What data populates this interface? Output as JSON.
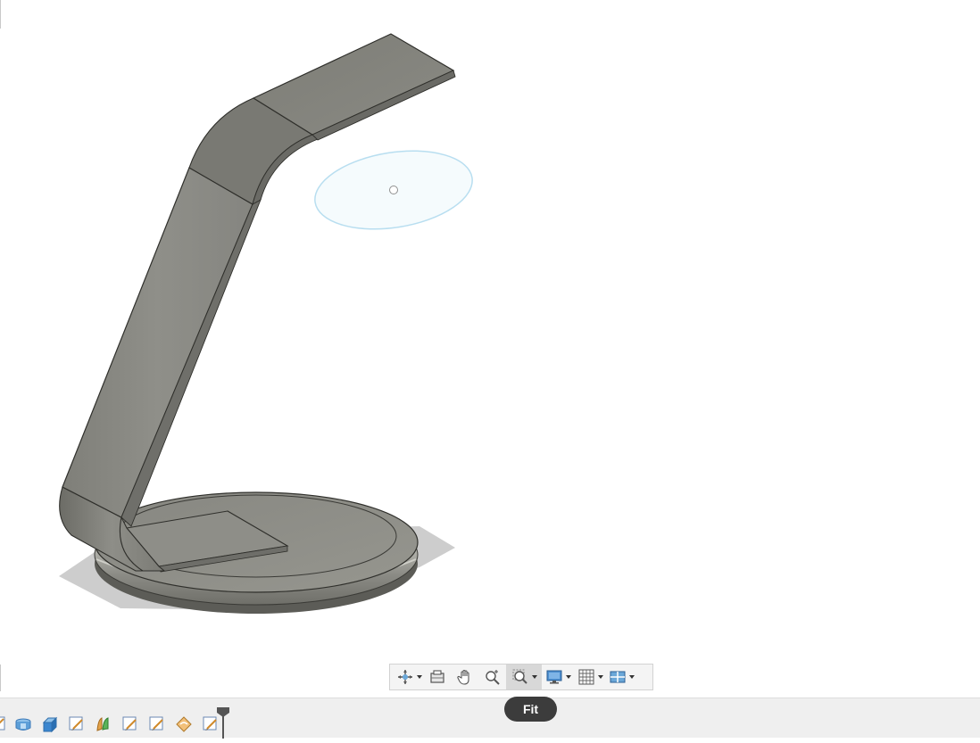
{
  "viewport": {
    "model": "lamp-stand-body",
    "sketch": "circle-sketch"
  },
  "navigation_toolbar": {
    "tools": [
      {
        "name": "orbit",
        "icon": "orbit-icon",
        "has_dropdown": true
      },
      {
        "name": "look-at",
        "icon": "look-at-icon",
        "has_dropdown": false
      },
      {
        "name": "pan",
        "icon": "pan-hand-icon",
        "has_dropdown": false
      },
      {
        "name": "zoom",
        "icon": "zoom-icon",
        "has_dropdown": false
      },
      {
        "name": "fit",
        "icon": "zoom-window-icon",
        "has_dropdown": true,
        "active": true
      },
      {
        "name": "display-settings",
        "icon": "display-icon",
        "has_dropdown": true
      },
      {
        "name": "grid-and-snaps",
        "icon": "grid-icon",
        "has_dropdown": true
      },
      {
        "name": "viewports",
        "icon": "viewports-icon",
        "has_dropdown": true
      }
    ]
  },
  "tooltip": {
    "text": "Fit"
  },
  "timeline": {
    "features": [
      {
        "type": "sketch",
        "icon": "sketch-icon"
      },
      {
        "type": "revolve",
        "icon": "revolve-icon"
      },
      {
        "type": "extrude",
        "icon": "extrude-icon"
      },
      {
        "type": "sketch",
        "icon": "sketch-icon"
      },
      {
        "type": "sweep",
        "icon": "sweep-icon"
      },
      {
        "type": "sketch",
        "icon": "sketch-icon"
      },
      {
        "type": "sketch",
        "icon": "sketch-icon"
      },
      {
        "type": "fillet",
        "icon": "fillet-icon"
      },
      {
        "type": "sketch",
        "icon": "sketch-icon"
      }
    ],
    "marker": "timeline-marker"
  },
  "colors": {
    "background": "#ffffff",
    "body": "#8a8a82",
    "sketch": "#bfe3f2",
    "toolbar": "#f4f4f4",
    "tooltip": "#3c3c3c",
    "timeline": "#efefef"
  }
}
